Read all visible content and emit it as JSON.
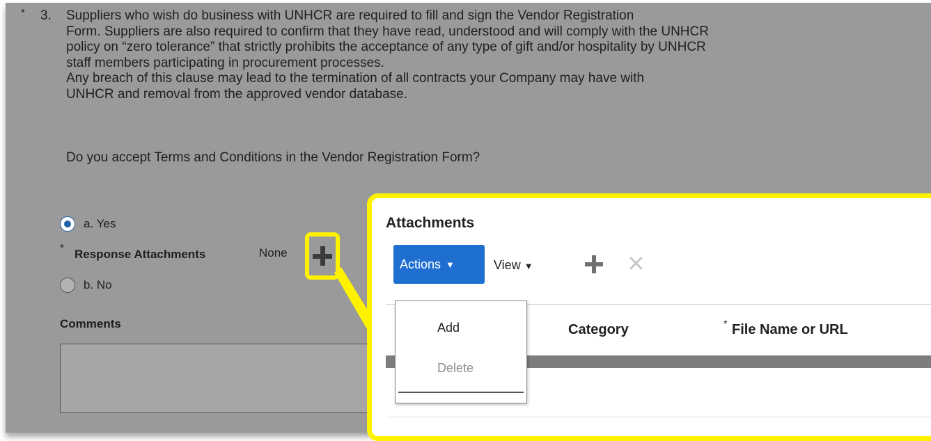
{
  "question": {
    "star": "*",
    "number": "3.",
    "lines": [
      "Suppliers who wish do business with UNHCR are required to fill and sign the Vendor Registration",
      "Form. Suppliers are also required to confirm that they have read, understood and will comply with the UNHCR",
      "policy on “zero tolerance” that strictly prohibits the acceptance of any type of gift and/or hospitality by UNHCR",
      "staff members participating in procurement processes.",
      "Any breach of this clause may lead to the termination of all contracts your Company may have with",
      "UNHCR and removal from the approved vendor database."
    ],
    "prompt": "Do you accept Terms and Conditions in the Vendor Registration Form?"
  },
  "options": {
    "yes_label": "a. Yes",
    "no_label": "b. No",
    "selected": "a. Yes"
  },
  "response_attachments": {
    "star": "*",
    "label": "Response Attachments",
    "value": "None"
  },
  "comments": {
    "label": "Comments"
  },
  "attachments_dialog": {
    "title": "Attachments",
    "actions_label": "Actions",
    "view_label": "View",
    "menu": {
      "add_label": "Add",
      "delete_label": "Delete"
    },
    "columns": {
      "category": "Category",
      "file_star": "*",
      "file": "File Name or URL"
    }
  },
  "colors": {
    "highlight": "#fff200",
    "actions_button": "#1f6fd0",
    "selected_radio": "#1f5fa8",
    "background_overlay": "#9a9a9a"
  }
}
